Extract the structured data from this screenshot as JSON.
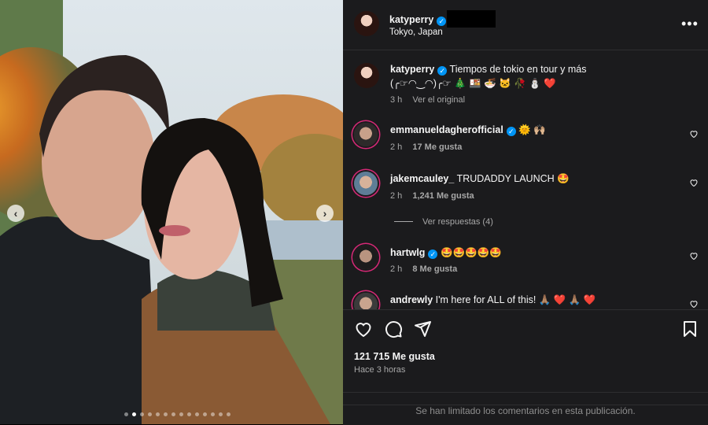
{
  "post": {
    "username": "katyperry",
    "location": "Tokyo, Japan",
    "caption_line1": "Tiempos de tokio en tour y más",
    "caption_line2": "(╭☞◠‿◠)╭☞ 🎄 🍱 🍜 🐱 🥀 ⛄ ❤️",
    "caption_time": "3 h",
    "caption_translate": "Ver el original",
    "likes": "121 715 Me gusta",
    "posted_ago": "Hace 3 horas",
    "comments_limited": "Se han limitado los comentarios en esta publicación."
  },
  "comments": [
    {
      "username": "emmanueldagherofficial",
      "text": "🌞 🙌🏼",
      "time": "2 h",
      "likes": "17 Me gusta",
      "verified": true
    },
    {
      "username": "jakemcauley_",
      "text": "TRUDADDY LAUNCH 🤩",
      "time": "2 h",
      "likes": "1,241 Me gusta",
      "verified": false
    },
    {
      "username": "hartwlg",
      "text": "🤩🤩🤩🤩🤩",
      "time": "2 h",
      "likes": "8 Me gusta",
      "verified": true
    },
    {
      "username": "andrewly",
      "text": "I'm here for ALL of this! 🙏🏽 ❤️ 🙏🏽 ❤️",
      "verified": false
    }
  ],
  "replies_label": "Ver respuestas (4)",
  "carousel": {
    "total_dots": 14,
    "active_index": 1
  },
  "icons": {
    "more": "more-options-icon",
    "like": "heart-icon",
    "comment": "comment-icon",
    "share": "share-icon",
    "save": "bookmark-icon",
    "prev": "chevron-left-icon",
    "next": "chevron-right-icon"
  },
  "colors": {
    "verified": "#0095f6",
    "panel_bg": "#1b1b1d",
    "heart_red": "#ed4956"
  }
}
